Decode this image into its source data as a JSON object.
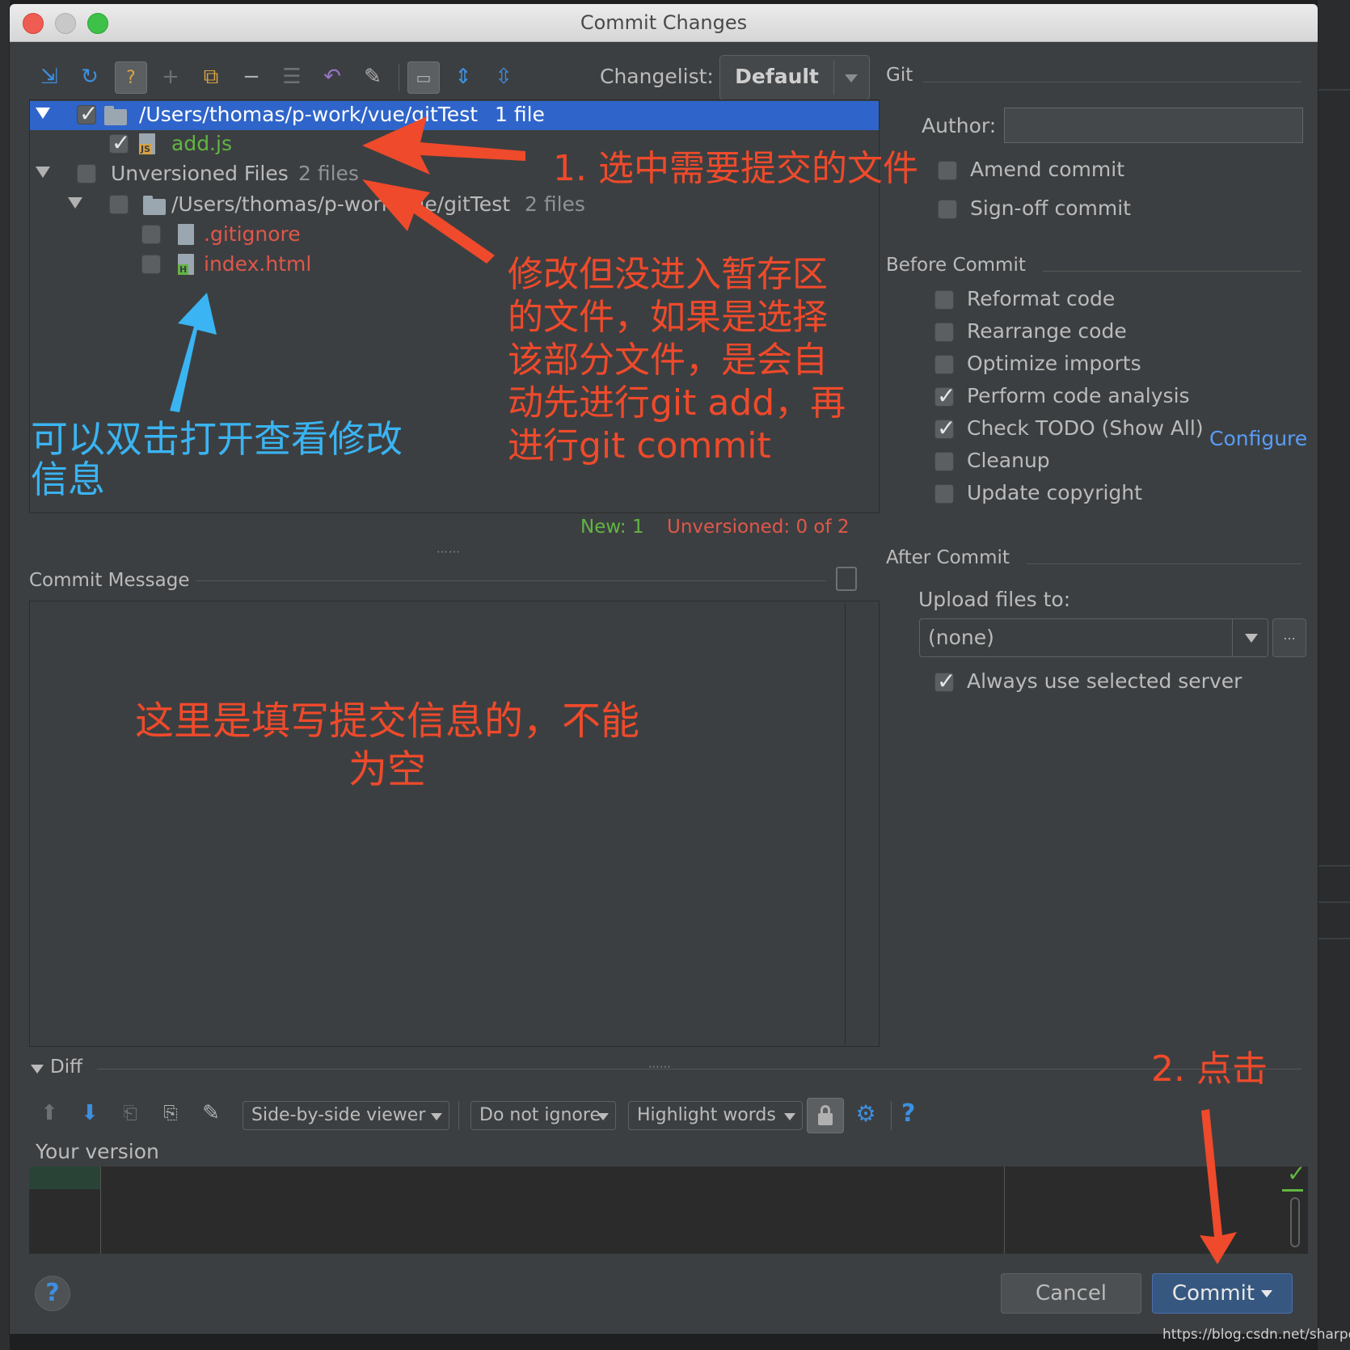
{
  "window": {
    "title": "Commit Changes"
  },
  "changelist": {
    "label": "Changelist:",
    "value": "Default"
  },
  "tree": {
    "rows": [
      {
        "name": "/Users/thomas/p-work/vue/gitTest",
        "count": "1 file"
      },
      {
        "name": "add.js",
        "badge": "JS"
      },
      {
        "name": "Unversioned Files",
        "count": "2 files"
      },
      {
        "name": "/Users/thomas/p-work/vue/gitTest",
        "count": "2 files"
      },
      {
        "name": ".gitignore"
      },
      {
        "name": "index.html",
        "badge": "H"
      }
    ],
    "status_new": "New: 1",
    "status_unversioned": "Unversioned: 0 of 2"
  },
  "git": {
    "section": "Git",
    "author_label": "Author:",
    "author_value": "",
    "amend": "Amend commit",
    "signoff": "Sign-off commit"
  },
  "before_commit": {
    "section": "Before Commit",
    "options": [
      {
        "label": "Reformat code",
        "checked": false
      },
      {
        "label": "Rearrange code",
        "checked": false
      },
      {
        "label": "Optimize imports",
        "checked": false
      },
      {
        "label": "Perform code analysis",
        "checked": true
      },
      {
        "label": "Check TODO (Show All)",
        "checked": true
      },
      {
        "label": "Cleanup",
        "checked": false
      },
      {
        "label": "Update copyright",
        "checked": false
      }
    ],
    "configure_link": "Configure"
  },
  "after_commit": {
    "section": "After Commit",
    "upload_label": "Upload files to:",
    "upload_value": "(none)",
    "browse": "...",
    "always_use": "Always use selected server"
  },
  "commit_message": {
    "label": "Commit Message",
    "value": ""
  },
  "diff": {
    "label": "Diff",
    "viewer": "Side-by-side viewer",
    "ignore": "Do not ignore",
    "highlight": "Highlight words",
    "help": "?",
    "your_version": "Your version"
  },
  "footer": {
    "help": "?",
    "cancel": "Cancel",
    "commit": "Commit"
  },
  "annotations": {
    "a1": "1. 选中需要提交的文件",
    "a2_lines": [
      "修改但没进入暂存区",
      "的文件，如果是选择",
      "该部分文件，是会自",
      "动先进行git add，再",
      "进行git commit"
    ],
    "a3_lines": [
      "可以双击打开查看修改",
      "信息"
    ],
    "a4_lines": [
      "这里是填写提交信息的，不能",
      "为空"
    ],
    "a5": "2. 点击"
  },
  "watermark": "https://blog.csdn.net/sharpdeng",
  "colors": {
    "selection": "#2f65ca",
    "annotation_red": "#ef4a2b",
    "annotation_blue": "#3ab4f2",
    "new_green": "#62b543",
    "unversioned_red": "#e0574a",
    "link_blue": "#589df6"
  }
}
